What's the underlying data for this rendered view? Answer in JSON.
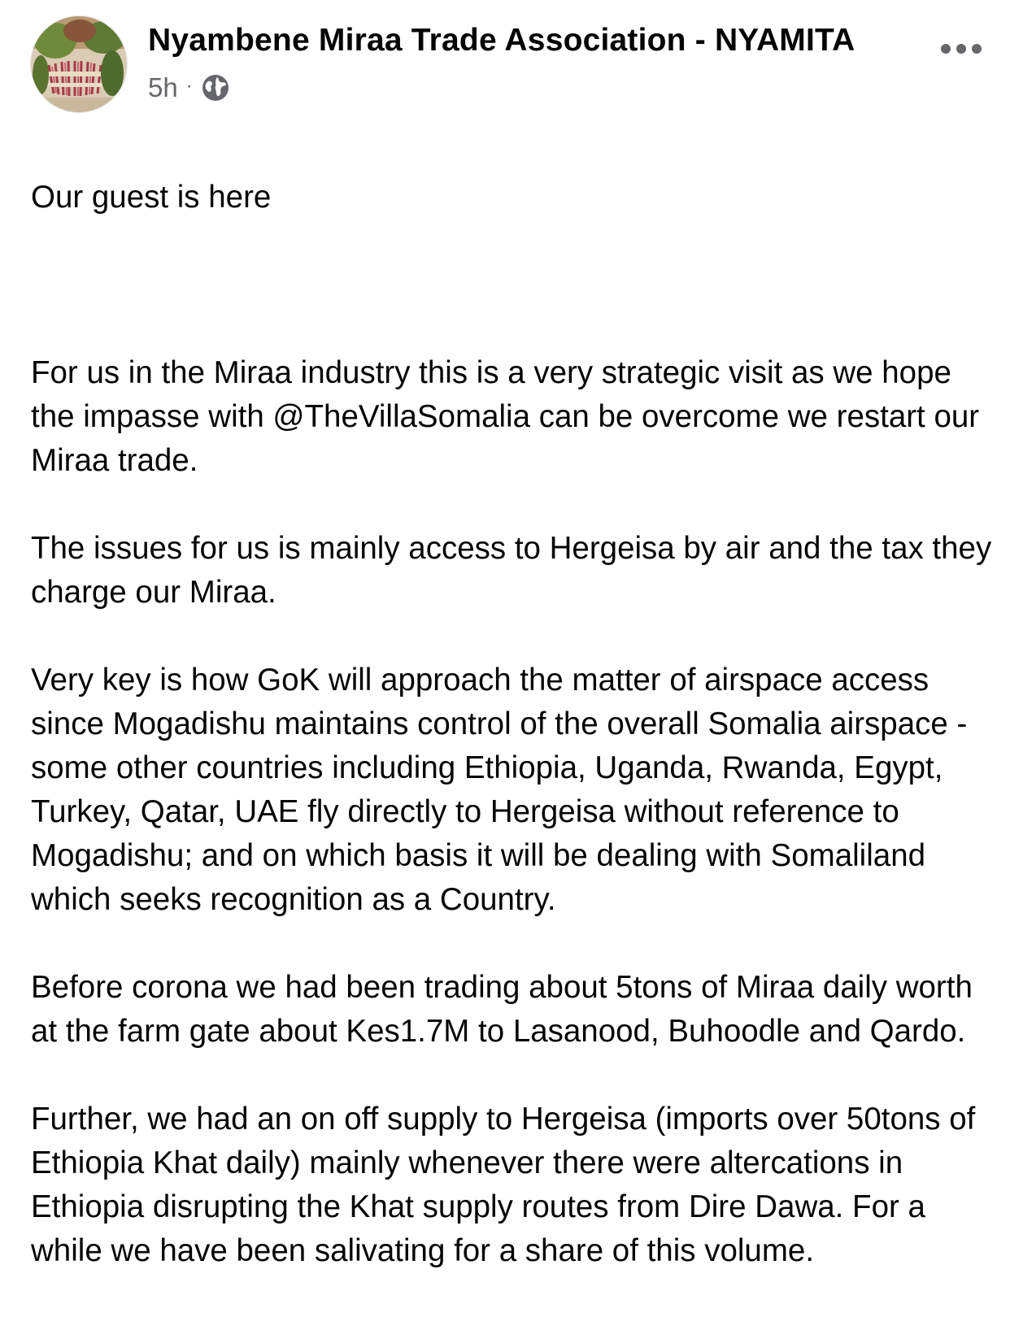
{
  "post": {
    "page_name": "Nyambene Miraa Trade Association - NYAMITA",
    "timestamp": "5h",
    "separator": "·",
    "privacy_icon": "globe-icon",
    "more_icon": "more-options-icon",
    "avatar_icon": "page-avatar",
    "body": {
      "intro": "Our guest is here",
      "paragraphs": [
        "For us in the Miraa industry this is a very strategic visit as we hope the impasse with @TheVillaSomalia can be overcome we restart our Miraa trade.",
        "The issues for us is mainly access to Hergeisa by air and the tax they charge our Miraa.",
        "Very key is how GoK will approach the matter of airspace access since Mogadishu maintains control of the overall Somalia airspace - some other countries including Ethiopia, Uganda, Rwanda, Egypt, Turkey, Qatar, UAE fly directly to Hergeisa without reference to Mogadishu; and on which basis it will be dealing with Somaliland which seeks recognition as a Country.",
        "Before corona we had been trading about 5tons of Miraa daily worth at the farm gate about Kes1.7M to Lasanood, Buhoodle and Qardo.",
        "Further, we had an on off supply to Hergeisa (imports over 50tons of Ethiopia Khat daily) mainly whenever there were altercations in Ethiopia disrupting the Khat supply routes from Dire Dawa. For a while we have been salivating for a share of this volume."
      ]
    }
  },
  "colors": {
    "text_primary": "#050505",
    "text_secondary": "#65676b",
    "background": "#ffffff"
  }
}
